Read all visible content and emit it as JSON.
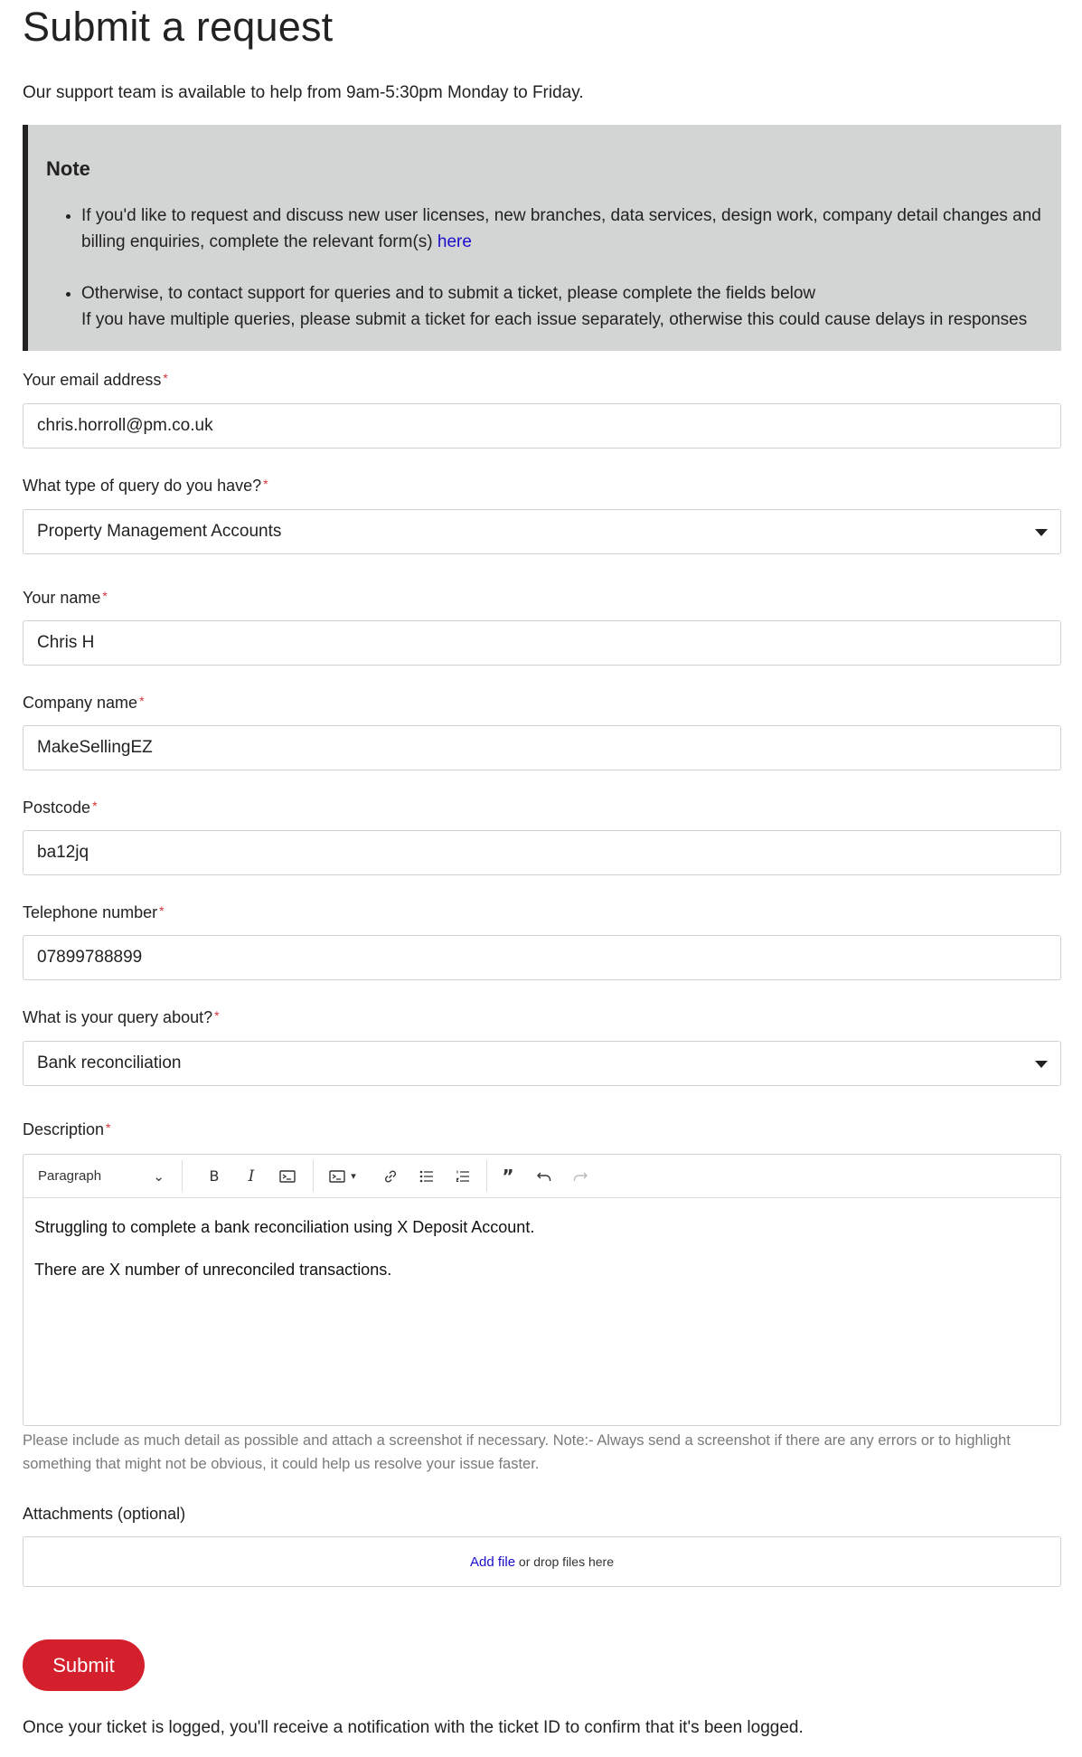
{
  "page": {
    "title": "Submit a request",
    "intro": "Our support team is available to help from 9am-5:30pm Monday to Friday."
  },
  "note": {
    "heading": "Note",
    "item1_text": "If you'd like to request and discuss new user licenses, new branches, data services, design work, company detail changes and billing enquiries, complete the relevant form(s) ",
    "item1_link": "here",
    "item2_line1": "Otherwise, to contact support for queries and to submit a ticket, please complete the fields below",
    "item2_line2": "If you have multiple queries, please submit a ticket for each issue separately, otherwise this could cause delays in responses"
  },
  "form": {
    "required_mark": "*",
    "email": {
      "label": "Your email address",
      "value": "chris.horroll@pm.co.uk"
    },
    "query_type": {
      "label": "What type of query do you have?",
      "value": "Property Management Accounts"
    },
    "name": {
      "label": "Your name",
      "value": "Chris H"
    },
    "company": {
      "label": "Company name",
      "value": "MakeSellingEZ"
    },
    "postcode": {
      "label": "Postcode",
      "value": "ba12jq"
    },
    "telephone": {
      "label": "Telephone number",
      "value": "07899788899"
    },
    "query_about": {
      "label": "What is your query about?",
      "value": "Bank reconciliation"
    },
    "description": {
      "label": "Description",
      "format_select": "Paragraph",
      "line1": "Struggling to complete a bank reconciliation using X Deposit Account.",
      "line2": "There are X number of unreconciled transactions.",
      "hint": "Please include as much detail as possible and attach a screenshot if necessary. Note:- Always send a screenshot if there are any errors or to highlight something that might not be obvious, it could help us resolve your issue faster."
    },
    "attachments": {
      "label": "Attachments (optional)",
      "add_file": "Add file",
      "drop_text": " or drop files here"
    },
    "submit_label": "Submit"
  },
  "footer": {
    "text": "Once your ticket is logged, you'll receive a notification with the ticket ID to confirm that it's been logged."
  }
}
